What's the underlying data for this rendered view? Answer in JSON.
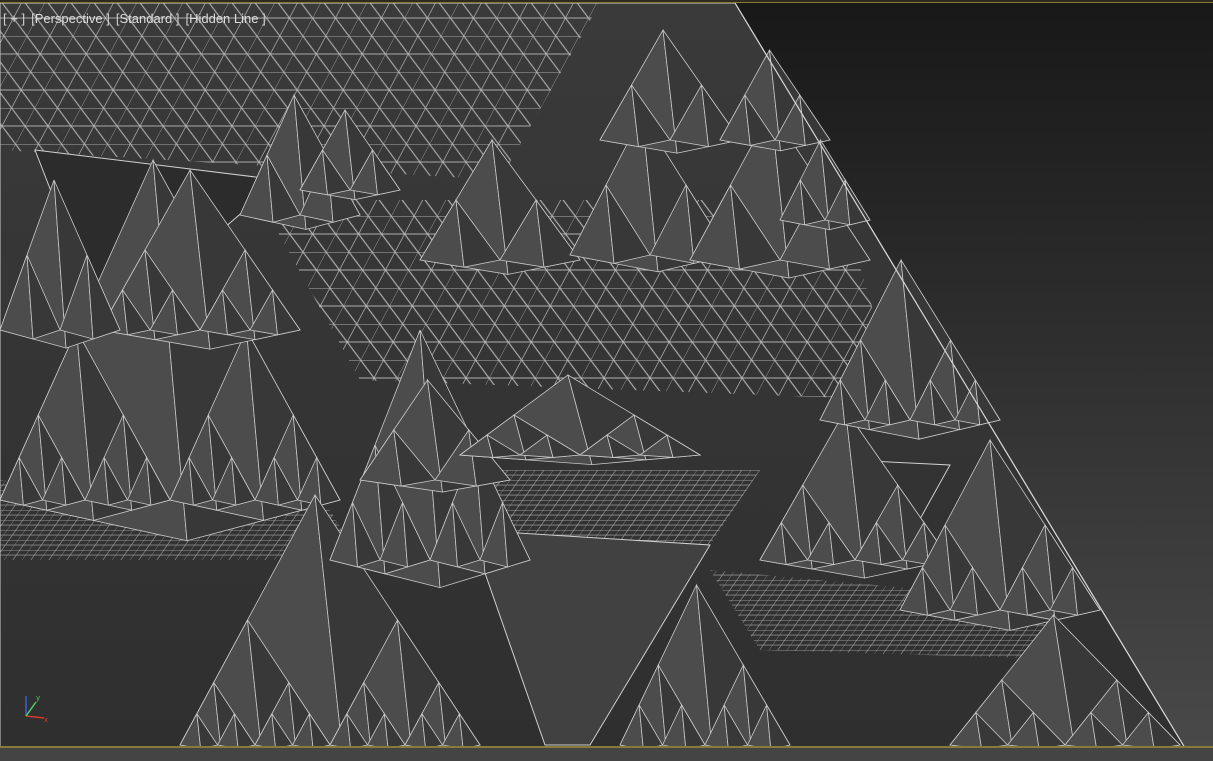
{
  "viewport": {
    "labels": [
      {
        "id": "plus-menu",
        "text": "+"
      },
      {
        "id": "view-type",
        "text": "Perspective"
      },
      {
        "id": "shading",
        "text": "Standard"
      },
      {
        "id": "display-mode",
        "text": "Hidden Line"
      }
    ],
    "gizmo": {
      "icon": "axis-tripod-icon"
    }
  },
  "colors": {
    "background_top": "#1a1a1a",
    "background_bottom": "#4a4a4a",
    "face_dark": "#383838",
    "face_light": "#4c4c4c",
    "edge": "#c9c9c9",
    "frame_accent": "#8a7a3a",
    "axis_x": "#d43a2a",
    "axis_y": "#4fd060",
    "axis_z": "#3a5fd8"
  }
}
